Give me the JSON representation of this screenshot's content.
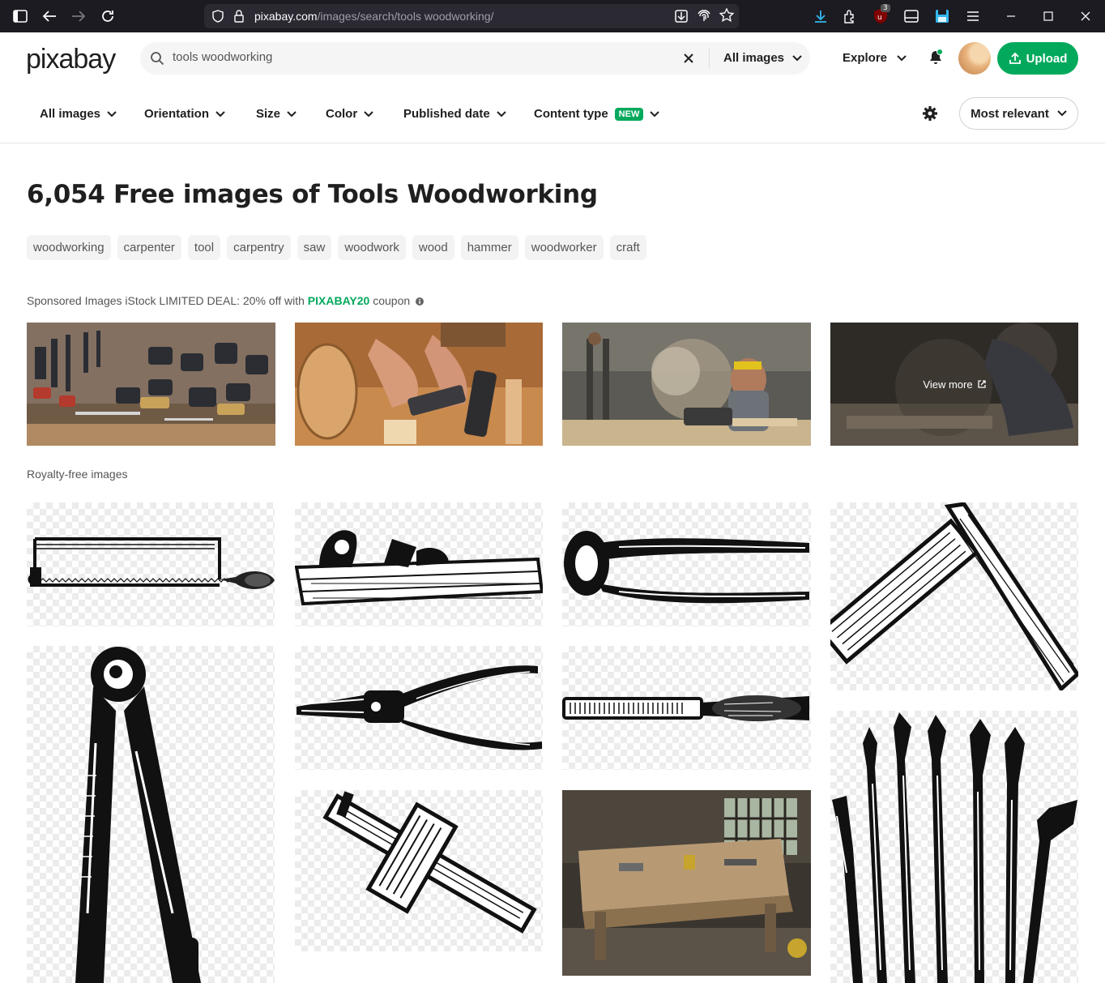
{
  "browser": {
    "url_host": "pixabay.com",
    "url_path": "/images/search/tools woodworking/",
    "extension_badge": "3"
  },
  "header": {
    "logo": "pixabay",
    "search_value": "tools woodworking",
    "search_type": "All images",
    "explore_label": "Explore",
    "upload_label": "Upload"
  },
  "filters": {
    "items": [
      "All images",
      "Orientation",
      "Size",
      "Color",
      "Published date",
      "Content type"
    ],
    "new_badge": "NEW",
    "sort_label": "Most relevant"
  },
  "main": {
    "title": "6,054 Free images of Tools Woodworking",
    "tags": [
      "woodworking",
      "carpenter",
      "tool",
      "carpentry",
      "saw",
      "woodwork",
      "wood",
      "hammer",
      "woodworker",
      "craft"
    ],
    "sponsored_prefix": "Sponsored Images iStock LIMITED DEAL: 20% off with ",
    "sponsored_code": "PIXABAY20",
    "sponsored_suffix": " coupon",
    "view_more": "View more",
    "section_label": "Royalty-free images"
  },
  "colors": {
    "brand_green": "#02a95c",
    "chrome_bg": "#1c1b22",
    "text": "#1f1f1f"
  }
}
